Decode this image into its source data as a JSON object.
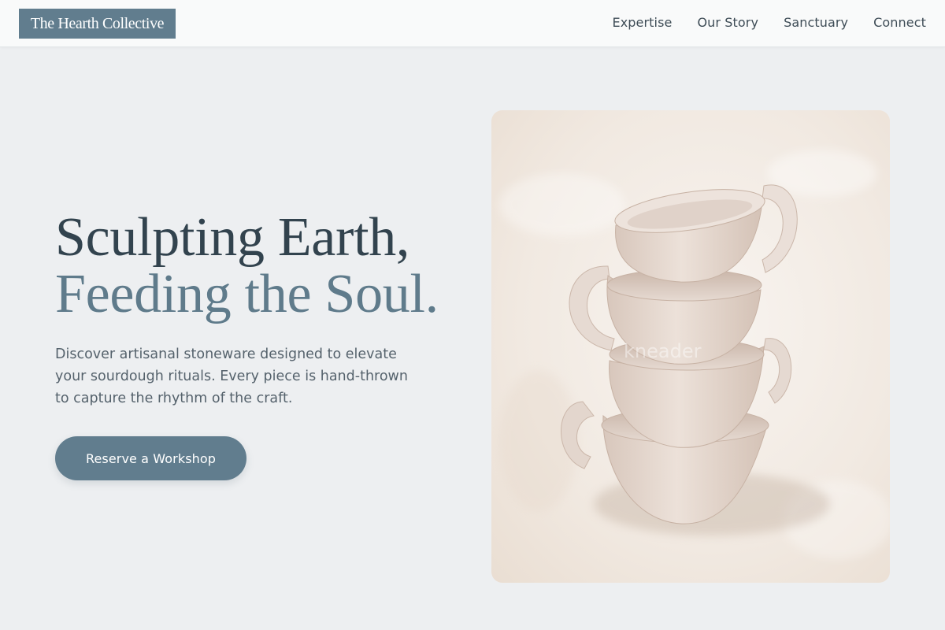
{
  "header": {
    "brand": "The Hearth Collective",
    "nav": [
      {
        "label": "Expertise"
      },
      {
        "label": "Our Story"
      },
      {
        "label": "Sanctuary"
      },
      {
        "label": "Connect"
      }
    ]
  },
  "hero": {
    "headline_line1": "Sculpting Earth,",
    "headline_line2": "Feeding the Soul.",
    "description": "Discover artisanal stoneware designed to elevate your sourdough rituals. Every piece is hand-thrown to capture the rhythm of the craft.",
    "cta_label": "Reserve a Workshop",
    "image_watermark": "kneader"
  },
  "colors": {
    "accent": "#617d8e",
    "heading_dark": "#32434e",
    "heading_accent": "#5f7b8b",
    "background": "#edeff1",
    "body_text": "#55626c"
  },
  "icons": {
    "hero_image": "stacked-clay-cups-photo"
  }
}
